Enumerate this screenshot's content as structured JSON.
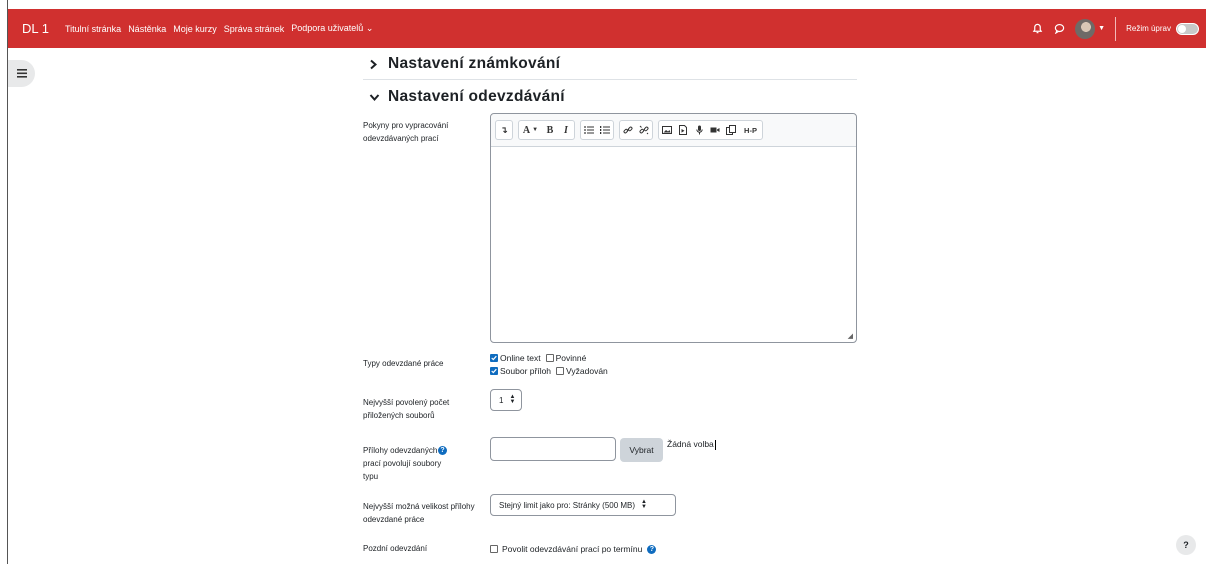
{
  "navbar": {
    "brand": "DL 1",
    "links": [
      "Titulní stránka",
      "Nástěnka",
      "Moje kurzy",
      "Správa stránek",
      "Podpora uživatelů ⌄"
    ],
    "edit_mode_label": "Režim úprav",
    "bg_color": "#d0302f",
    "icons": [
      "bell-icon",
      "chat-icon",
      "avatar",
      "chevron-down-icon",
      "toggle"
    ]
  },
  "sections": {
    "grading": "Nastavení známkování",
    "submission": "Nastavení odevzdávání"
  },
  "form": {
    "instructions_label": "Pokyny pro vypracování odevzdávaných prací",
    "submission_types_label": "Typy odevzdané práce",
    "online_text": "Online text",
    "required1": "Povinné",
    "file_submission": "Soubor příloh",
    "required2": "Vyžadován",
    "max_files_label": "Nejvyšší povolený počet přiložených souborů",
    "max_files_value": "1",
    "accepted_types_label": "Přílohy odevzdaných prací povolují soubory typu",
    "choose_button": "Vybrat",
    "no_choice": "Žádná volba",
    "max_size_label": "Nejvyšší možná velikost přílohy odevzdané práce",
    "max_size_value": "Stejný limit jako pro: Stránky (500 MB)",
    "late_label": "Pozdní odevzdání",
    "late_option": "Povolit odevzdávání prací po termínu",
    "online_text_checked": true,
    "file_submission_checked": true
  },
  "editor_toolbar": {
    "font_label": "A",
    "bold": "B",
    "italic": "I",
    "h5p": "H-P"
  },
  "help_fab": "?"
}
